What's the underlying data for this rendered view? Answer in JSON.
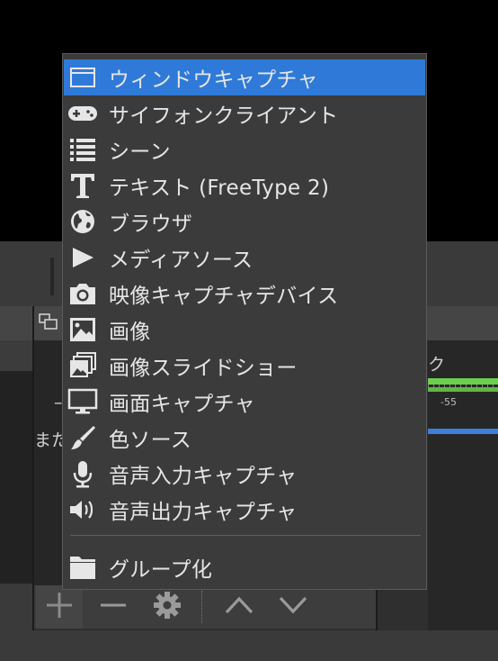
{
  "background": {
    "fragment_label_1": "–",
    "fragment_label_2": "また",
    "fragment_label_3": "ク",
    "meter_tick_label": "-55"
  },
  "menu": {
    "items": [
      {
        "label": "ウィンドウキャプチャ",
        "icon": "window-icon",
        "selected": true
      },
      {
        "label": "サイフォンクライアント",
        "icon": "gamepad-icon"
      },
      {
        "label": "シーン",
        "icon": "list-icon"
      },
      {
        "label": "テキスト (FreeType 2)",
        "icon": "text-icon"
      },
      {
        "label": "ブラウザ",
        "icon": "globe-icon"
      },
      {
        "label": "メディアソース",
        "icon": "play-icon"
      },
      {
        "label": "映像キャプチャデバイス",
        "icon": "camera-icon"
      },
      {
        "label": "画像",
        "icon": "image-icon"
      },
      {
        "label": "画像スライドショー",
        "icon": "slideshow-icon"
      },
      {
        "label": "画面キャプチャ",
        "icon": "monitor-icon"
      },
      {
        "label": "色ソース",
        "icon": "brush-icon"
      },
      {
        "label": "音声入力キャプチャ",
        "icon": "microphone-icon"
      },
      {
        "label": "音声出力キャプチャ",
        "icon": "speaker-icon"
      },
      {
        "label": "グループ化",
        "icon": "folder-icon"
      }
    ]
  },
  "toolbar": {
    "add": "+",
    "remove": "−"
  },
  "colors": {
    "selected": "#2f7ad8",
    "menu_bg": "#3b3b3b",
    "meter_green": "#6ccf4d",
    "meter_blue": "#3d7fd6"
  }
}
